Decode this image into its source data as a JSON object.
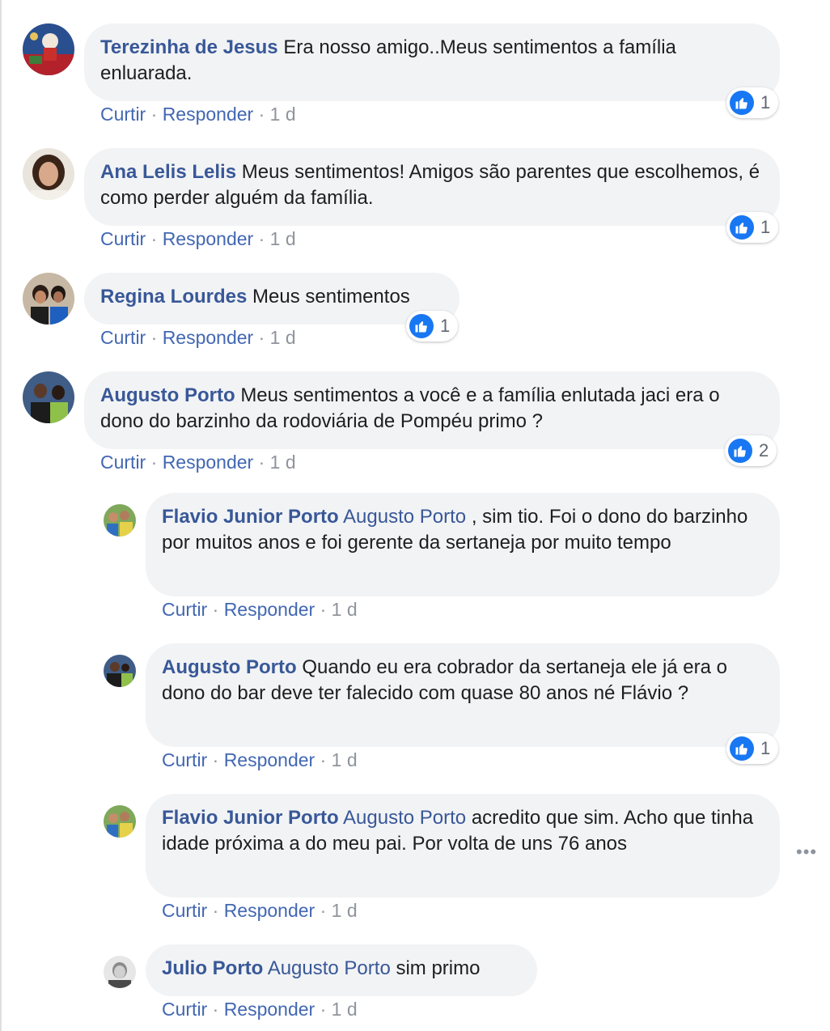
{
  "colors": {
    "author": "#385898",
    "action_link": "#4267b2",
    "bubble_bg": "#f2f3f5",
    "like_blue": "#1877f2",
    "meta_gray": "#90949c"
  },
  "comments": [
    {
      "author": "Terezinha de Jesus",
      "text": "Era nosso amigo..Meus sentimentos a família enluarada.",
      "like_label": "Curtir",
      "reply_label": "Responder",
      "time": "1 d",
      "reactions": "1",
      "avatar_icon": "profile-photo"
    },
    {
      "author": "Ana Lelis Lelis",
      "text": "Meus sentimentos! Amigos são parentes que escolhemos, é como perder alguém da família.",
      "like_label": "Curtir",
      "reply_label": "Responder",
      "time": "1 d",
      "reactions": "1",
      "avatar_icon": "profile-photo"
    },
    {
      "author": "Regina Lourdes",
      "text": "Meus sentimentos",
      "like_label": "Curtir",
      "reply_label": "Responder",
      "time": "1 d",
      "reactions": "1",
      "avatar_icon": "profile-photo"
    },
    {
      "author": "Augusto Porto",
      "text": "Meus sentimentos a você e a família enlutada jaci era o dono do barzinho da rodoviária de Pompéu primo ?",
      "like_label": "Curtir",
      "reply_label": "Responder",
      "time": "1 d",
      "reactions": "2",
      "avatar_icon": "profile-photo"
    }
  ],
  "replies": [
    {
      "author": "Flavio Junior Porto",
      "mention": "Augusto Porto",
      "text": ", sim tio. Foi o dono do barzinho por muitos anos e foi gerente da sertaneja por muito tempo",
      "like_label": "Curtir",
      "reply_label": "Responder",
      "time": "1 d"
    },
    {
      "author": "Augusto Porto",
      "mention": "",
      "text": "Quando eu era cobrador da sertaneja ele já era o dono do bar deve ter falecido com quase 80 anos né Flávio ?",
      "like_label": "Curtir",
      "reply_label": "Responder",
      "time": "1 d",
      "reactions": "1"
    },
    {
      "author": "Flavio Junior Porto",
      "mention": "Augusto Porto",
      "text": "acredito que sim. Acho que tinha idade próxima a do meu pai. Por volta de uns 76 anos",
      "like_label": "Curtir",
      "reply_label": "Responder",
      "time": "1 d"
    },
    {
      "author": "Julio Porto",
      "mention": "Augusto Porto",
      "text": "sim primo",
      "like_label": "Curtir",
      "reply_label": "Responder",
      "time": "1 d"
    }
  ],
  "more_options": "•••"
}
